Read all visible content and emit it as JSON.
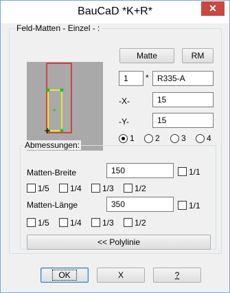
{
  "window": {
    "title": "BauCaD *K+R*",
    "close_glyph": "✕"
  },
  "group_main": {
    "legend": "Feld-Matten - Einzel - :"
  },
  "buttons": {
    "matte": "Matte",
    "rm": "RM",
    "polylinie": "<< Polylinie",
    "ok": "OK",
    "x": "X",
    "help": "?"
  },
  "count": {
    "value": "1",
    "times": "*",
    "type_value": "R335-A"
  },
  "offset": {
    "x_label": "-X-",
    "x_value": "15",
    "y_label": "-Y-",
    "y_value": "15"
  },
  "radios": {
    "selected": "1",
    "options": [
      "1",
      "2",
      "3",
      "4"
    ]
  },
  "group_dims": {
    "legend": "Abmessungen:"
  },
  "breite": {
    "label": "Matten-Breite",
    "value": "150",
    "full": "1/1"
  },
  "laenge": {
    "label": "Matten-Länge",
    "value": "350",
    "full": "1/1"
  },
  "fractions": [
    "1/5",
    "1/4",
    "1/3",
    "1/2"
  ],
  "colors": {
    "outline": "#e02020",
    "mat": "#ffff00",
    "marker": "#20c020",
    "preview_bg": "#a9a9a9"
  }
}
